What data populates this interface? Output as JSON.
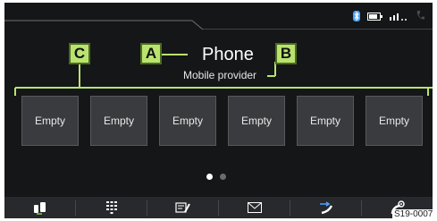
{
  "header": {
    "title": "Phone",
    "subtitle": "Mobile provider"
  },
  "callouts": {
    "a": "A",
    "b": "B",
    "c": "C"
  },
  "favorites": [
    "Empty",
    "Empty",
    "Empty",
    "Empty",
    "Empty",
    "Empty"
  ],
  "pagination": {
    "current": 1,
    "total": 2
  },
  "bottom_bar": {
    "icons": [
      "phone-devices-icon",
      "keypad-icon",
      "contacts-icon",
      "messages-icon",
      "call-list-icon",
      "phone-settings-icon"
    ]
  },
  "figure_ref": "S19-0007",
  "colors": {
    "screen_bg": "#151618",
    "callout_fill": "#b9e36f",
    "callout_border": "#4c6a1f",
    "bluetooth": "#4da3ff",
    "accent_green": "#7fd146"
  }
}
